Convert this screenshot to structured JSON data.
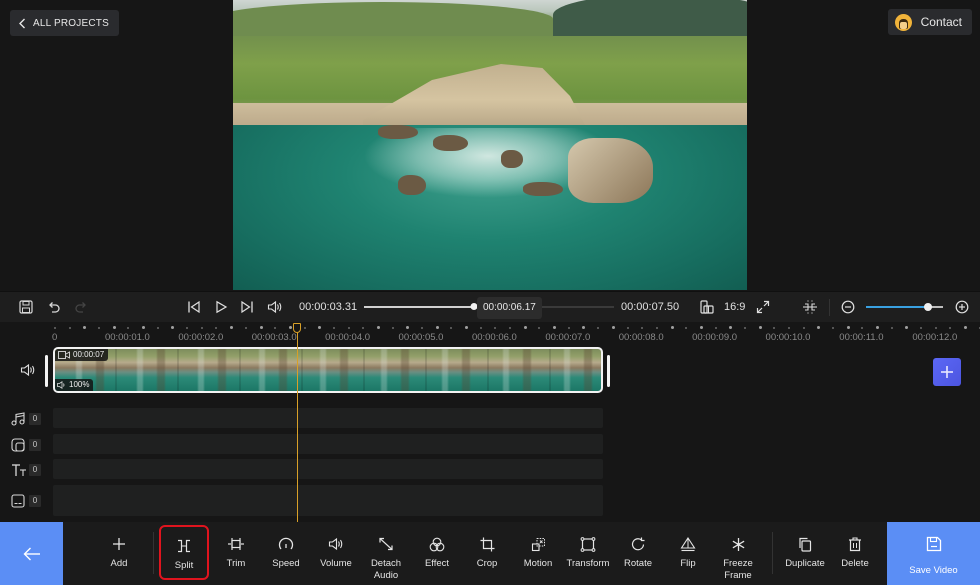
{
  "header": {
    "back_label": "ALL PROJECTS",
    "contact_label": "Contact"
  },
  "preview": {
    "description": "Aerial view of coastal cliffs, rocks and turquoise sea"
  },
  "player": {
    "current_time": "00:00:03.31",
    "hover_time": "00:00:06.17",
    "total_time": "00:00:07.50",
    "progress_fraction": 0.44,
    "aspect_ratio": "16:9",
    "timeline_zoom_fraction": 0.8
  },
  "timeline": {
    "ruler_labels": [
      "0",
      "00:00:01.0",
      "00:00:02.0",
      "00:00:03.0",
      "00:00:04.0",
      "00:00:05.0",
      "00:00:06.0",
      "00:00:07.0",
      "00:00:08.0",
      "00:00:09.0",
      "00:00:10.0",
      "00:00:11.0",
      "00:00:12.0"
    ],
    "playhead_time_seconds": 3.31,
    "clip": {
      "duration": "00:00:07",
      "volume": "100%"
    },
    "tracks": [
      {
        "icon": "music-icon",
        "count": "0"
      },
      {
        "icon": "sticker-icon",
        "count": "0"
      },
      {
        "icon": "text-icon",
        "count": "0"
      },
      {
        "icon": "subtitle-icon",
        "count": "0"
      }
    ]
  },
  "toolbar": {
    "tools": [
      {
        "id": "add",
        "label": "Add"
      },
      {
        "id": "split",
        "label": "Split",
        "selected": true
      },
      {
        "id": "trim",
        "label": "Trim"
      },
      {
        "id": "speed",
        "label": "Speed"
      },
      {
        "id": "volume",
        "label": "Volume"
      },
      {
        "id": "detach-audio",
        "label": "Detach\nAudio"
      },
      {
        "id": "effect",
        "label": "Effect"
      },
      {
        "id": "crop",
        "label": "Crop"
      },
      {
        "id": "motion",
        "label": "Motion"
      },
      {
        "id": "transform",
        "label": "Transform"
      },
      {
        "id": "rotate",
        "label": "Rotate"
      },
      {
        "id": "flip",
        "label": "Flip"
      },
      {
        "id": "freeze-frame",
        "label": "Freeze\nFrame"
      },
      {
        "id": "duplicate",
        "label": "Duplicate"
      },
      {
        "id": "delete",
        "label": "Delete"
      }
    ],
    "save_label": "Save Video"
  },
  "colors": {
    "accent_blue": "#5b8ef5",
    "add_track_purple": "#5b67f5",
    "playhead": "#d8a028",
    "selection_red": "#e0141e",
    "zoom_slider": "#39a0e0"
  }
}
